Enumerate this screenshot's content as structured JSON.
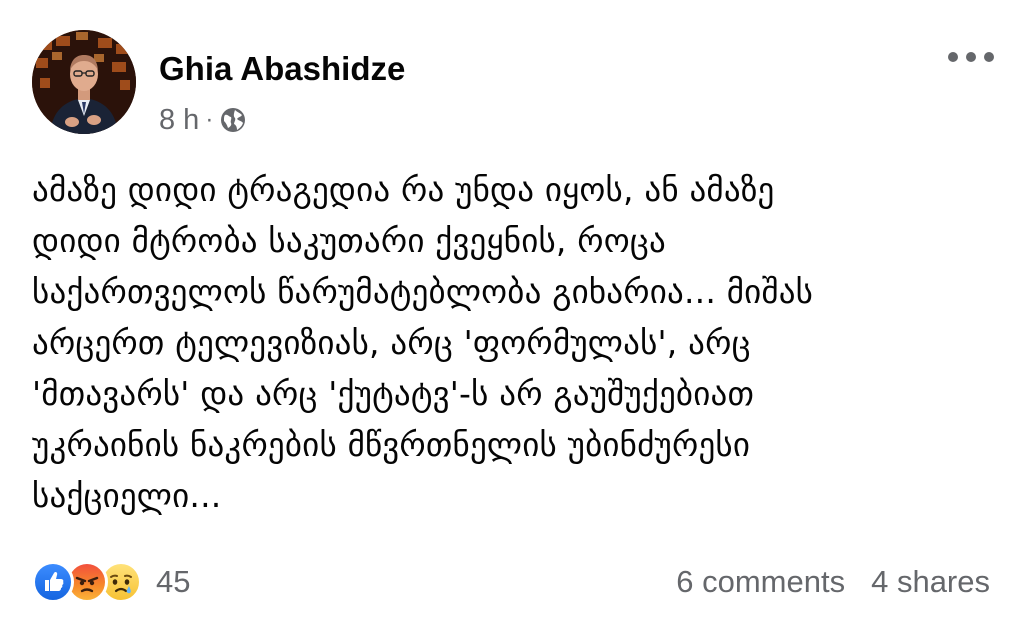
{
  "post": {
    "author": "Ghia Abashidze",
    "time": "8 h",
    "separator": "·",
    "privacy_icon": "globe-icon",
    "more_icon": "more-horizontal-icon",
    "text": "ამაზე დიდი ტრაგედია რა უნდა იყოს, ან ამაზე\nდიდი მტრობა საკუთარი ქვეყნის, როცა\nსაქართველოს წარუმატებლობა გიხარია... მიშას\nარცერთ ტელევიზიას, არც 'ფორმულას', არც\n'მთავარს' და არც 'ქუტატვ'-ს არ გაუშუქებიათ\nუკრაინის ნაკრების მწვრთნელის უბინძურესი\nსაქციელი..."
  },
  "footer": {
    "reactions": [
      "like-icon",
      "angry-icon",
      "sad-icon"
    ],
    "reaction_count": "45",
    "comments": "6 comments",
    "shares": "4 shares"
  },
  "colors": {
    "text": "#050505",
    "secondary": "#65676b",
    "like": "#1877f2"
  }
}
